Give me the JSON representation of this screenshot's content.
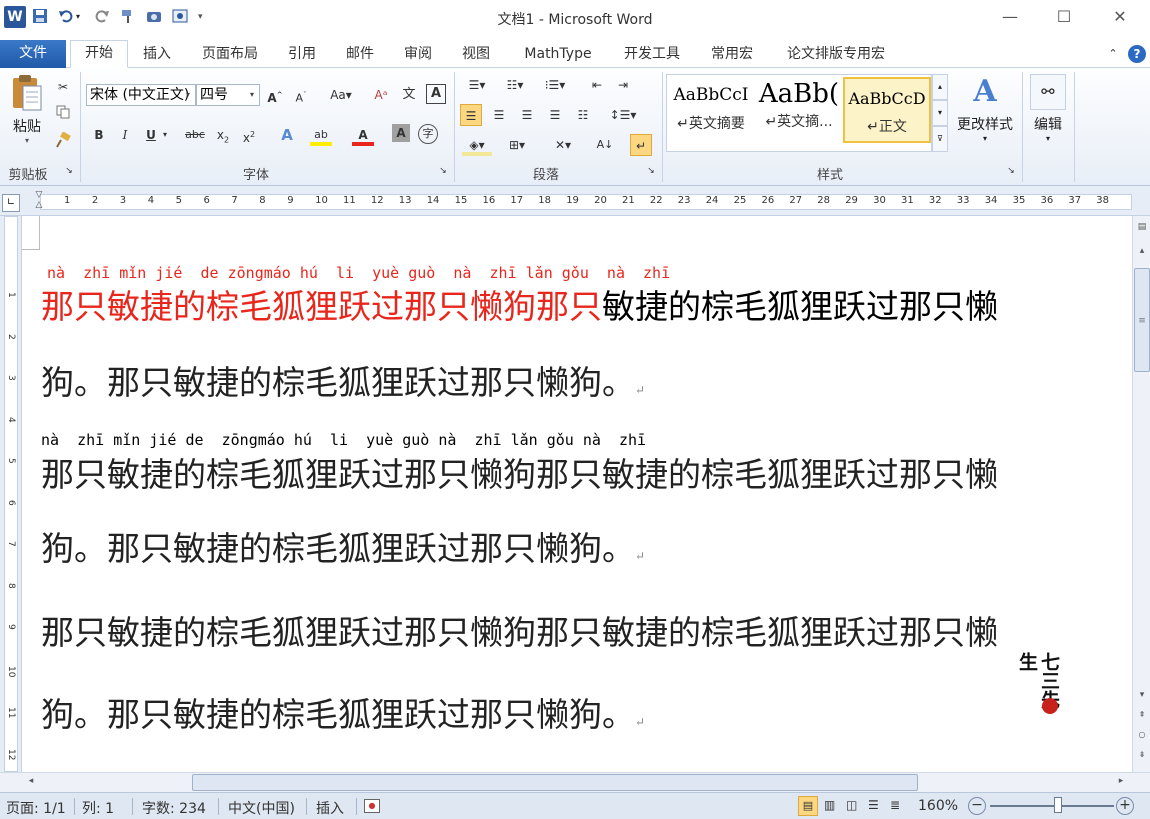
{
  "window": {
    "title": "文档1 - Microsoft Word",
    "word_logo": "W",
    "minimize_icon": "—",
    "maximize_icon": "☐",
    "close_icon": "✕"
  },
  "tabs": [
    "文件",
    "开始",
    "插入",
    "页面布局",
    "引用",
    "邮件",
    "审阅",
    "视图",
    "MathType",
    "开发工具",
    "常用宏",
    "论文排版专用宏"
  ],
  "active_tab": "开始",
  "ribbon": {
    "clipboard": {
      "paste_label": "粘贴",
      "group_label": "剪贴板"
    },
    "font": {
      "font_name": "宋体 (中文正文)",
      "font_size": "四号",
      "group_label": "字体"
    },
    "paragraph": {
      "group_label": "段落"
    },
    "styles": {
      "group_label": "样式",
      "items": [
        {
          "sample": "AaBbCcI",
          "name": "↵英文摘要"
        },
        {
          "sample": "AaBb(",
          "name": "↵英文摘..."
        },
        {
          "sample": "AaBbCcD",
          "name": "↵正文"
        }
      ],
      "change_styles_label": "更改样式",
      "edit_label": "编辑"
    }
  },
  "ruler": {
    "numbers": [
      "1",
      "2",
      "3",
      "4",
      "5",
      "6",
      "7",
      "8",
      "9",
      "10",
      "11",
      "12",
      "13",
      "14",
      "15",
      "16",
      "17",
      "18",
      "19",
      "20",
      "21",
      "22",
      "23",
      "24",
      "25",
      "26",
      "27",
      "28",
      "29",
      "30",
      "31",
      "32",
      "33",
      "34",
      "35",
      "36",
      "37",
      "38"
    ],
    "vnumbers": [
      "1",
      "2",
      "3",
      "4",
      "5",
      "6",
      "7",
      "8",
      "9",
      "10",
      "11",
      "12"
    ]
  },
  "document": {
    "para1": {
      "pinyin": "nà  zhī mǐn jié  de zōngmáo hú  li  yuè guò  nà  zhī lǎn gǒu  nà  zhī",
      "line1_red": "那只敏捷的棕毛狐狸跃过那只懒狗那只",
      "line1_black": "敏捷的棕毛狐狸跃过那只懒",
      "line2": "狗。那只敏捷的棕毛狐狸跃过那只懒狗。"
    },
    "para2": {
      "pinyin": "nà  zhī mǐn jié de  zōngmáo hú  li  yuè guò nà  zhī lǎn gǒu nà  zhī",
      "line1": "那只敏捷的棕毛狐狸跃过那只懒狗那只敏捷的棕毛狐狸跃过那只懒",
      "line2": "狗。那只敏捷的棕毛狐狸跃过那只懒狗。"
    },
    "para3": {
      "line1": "那只敏捷的棕毛狐狸跃过那只懒狗那只敏捷的棕毛狐狸跃过那只懒",
      "line2": "狗。那只敏捷的棕毛狐狸跃过那只懒狗。"
    },
    "paragraph_mark": "↵",
    "watermark": "七三先生"
  },
  "statusbar": {
    "page": "页面: 1/1",
    "column": "列: 1",
    "word_count": "字数: 234",
    "language": "中文(中国)",
    "insert_mode": "插入",
    "zoom": "160%"
  },
  "colors": {
    "accent": "#2b579a",
    "pinyin_red": "#e8261c",
    "text_red": "#e8261c",
    "text_black": "#000000"
  }
}
